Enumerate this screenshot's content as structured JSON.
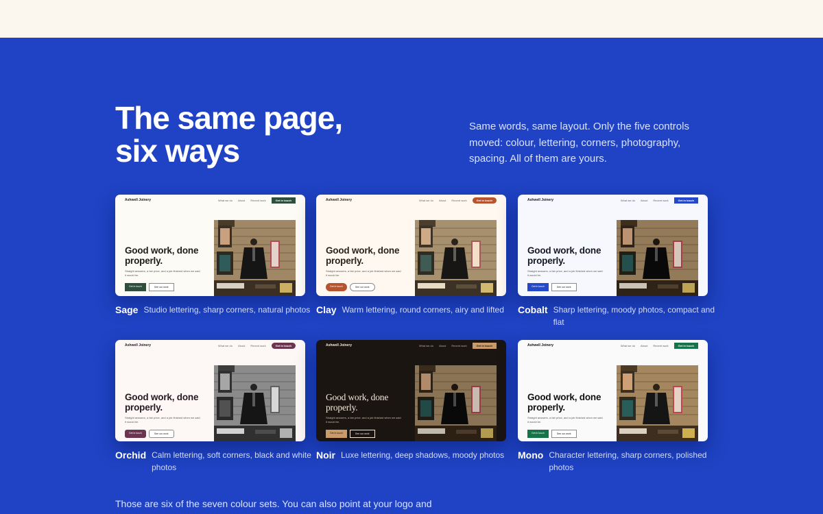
{
  "heading": "The same page, six ways",
  "intro": "Same words, same layout. Only the five controls moved: colour, lettering, corners, photography, spacing. All of them are yours.",
  "footer_text": "Those are six of the seven colour sets. You can also point at your logo and",
  "preview": {
    "brand": "Ashwell Joinery",
    "nav_links": [
      "What we do",
      "About",
      "Recent work"
    ],
    "nav_cta": "Get in touch",
    "hero_title": "Good work, done properly.",
    "hero_sub": "Straight answers, a fair price, and a job finished when we said it would be.",
    "primary_button": "Get in touch",
    "secondary_button": "See our work"
  },
  "variants": [
    {
      "name": "Sage",
      "description": "Studio lettering, sharp corners, natural photos",
      "bg": "#fdfbf6",
      "ink": "#1b1d1a",
      "accent": "#2f4f3c",
      "photo_filter": "none"
    },
    {
      "name": "Clay",
      "description": "Warm lettering, round corners, airy and lifted",
      "bg": "#fff8f0",
      "ink": "#2a1f1a",
      "accent": "#b5542f",
      "photo_filter": "sepia(0.25)"
    },
    {
      "name": "Cobalt",
      "description": "Sharp lettering, moody photos, compact and flat",
      "bg": "#f7f8fd",
      "ink": "#141824",
      "accent": "#2448c8",
      "photo_filter": "contrast(1.1) brightness(0.9)"
    },
    {
      "name": "Orchid",
      "description": "Calm lettering, soft corners, black and white photos",
      "bg": "#fdf8f6",
      "ink": "#231a22",
      "accent": "#6b3550",
      "photo_filter": "grayscale(1)"
    },
    {
      "name": "Noir",
      "description": "Luxe lettering, deep shadows, moody photos",
      "bg": "#1a1511",
      "ink": "#f3e8da",
      "accent": "#c99b6a",
      "photo_filter": "contrast(1.1) brightness(0.85)"
    },
    {
      "name": "Mono",
      "description": "Character lettering, sharp corners, polished photos",
      "bg": "#fafafa",
      "ink": "#111111",
      "accent": "#16734a",
      "photo_filter": "saturate(1.2)"
    }
  ]
}
